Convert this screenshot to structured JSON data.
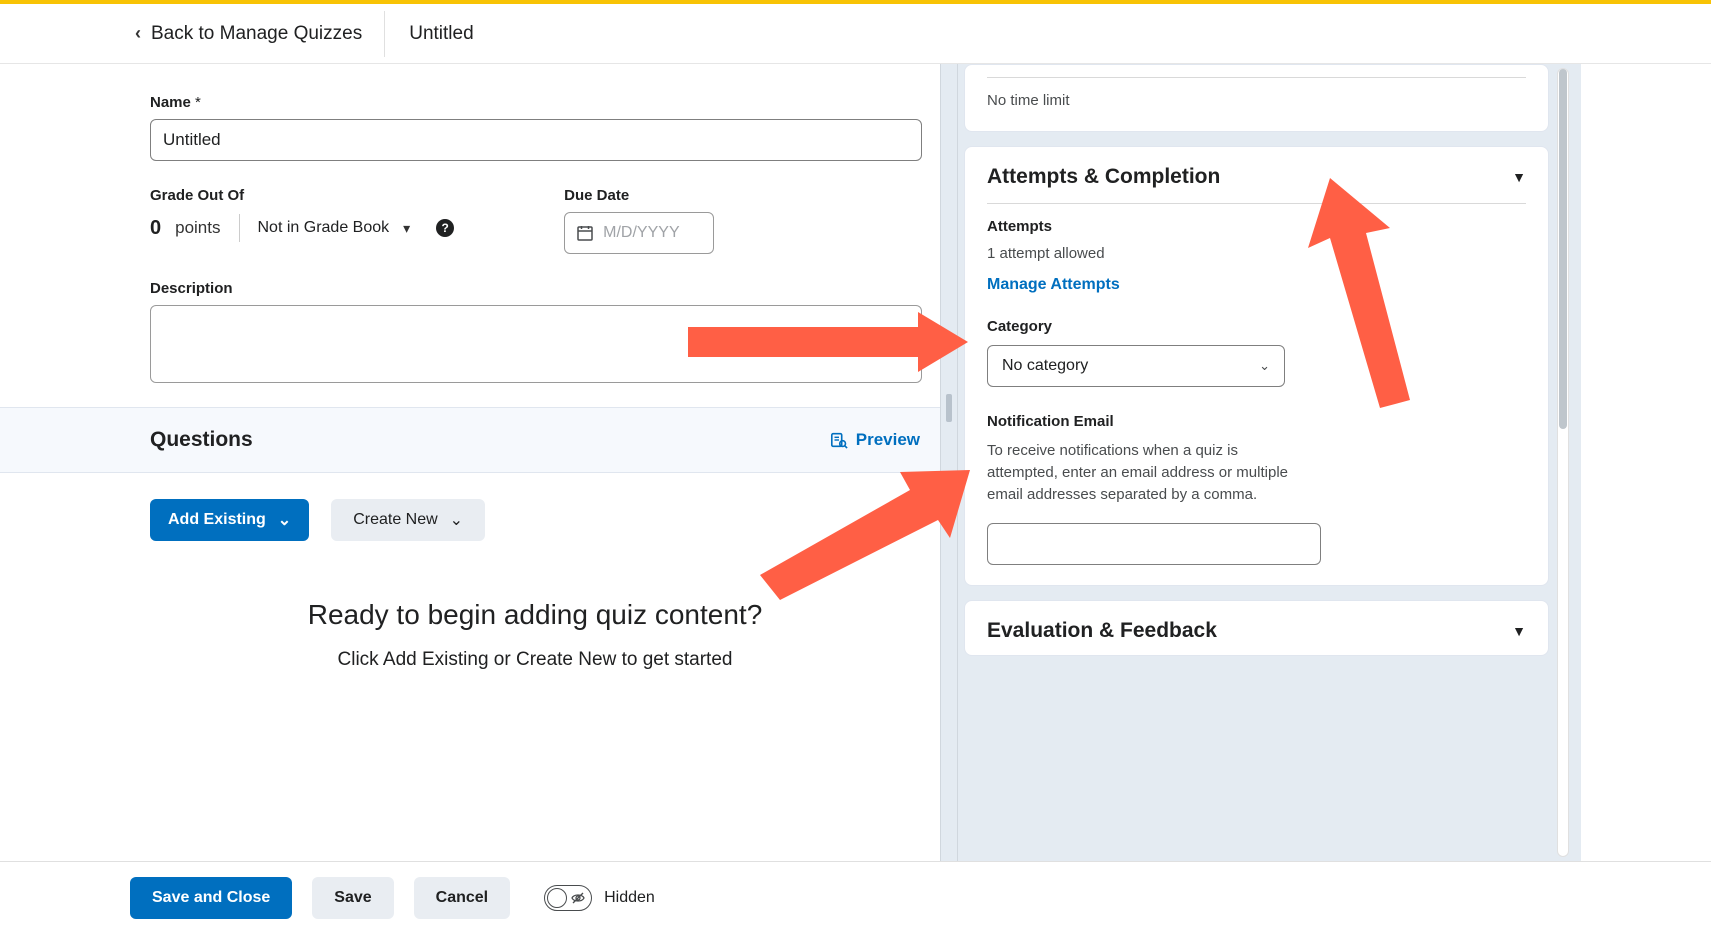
{
  "header": {
    "back_label": "Back to Manage Quizzes",
    "title": "Untitled"
  },
  "form": {
    "name_label": "Name",
    "name_value": "Untitled",
    "grade_label": "Grade Out Of",
    "grade_points_num": "0",
    "grade_points_word": "points",
    "gradebook_label": "Not in Grade Book",
    "due_date_label": "Due Date",
    "due_date_placeholder": "M/D/YYYY",
    "description_label": "Description"
  },
  "questions": {
    "heading": "Questions",
    "preview_label": "Preview",
    "add_existing_label": "Add Existing",
    "create_new_label": "Create New",
    "empty_title": "Ready to begin adding quiz content?",
    "empty_sub": "Click Add Existing or Create New to get started"
  },
  "side": {
    "timing_text": "No time limit",
    "attempts_title": "Attempts & Completion",
    "attempts_label": "Attempts",
    "attempts_value": "1 attempt allowed",
    "manage_attempts": "Manage Attempts",
    "category_label": "Category",
    "category_value": "No category",
    "notif_label": "Notification Email",
    "notif_desc": "To receive notifications when a quiz is attempted, enter an email address or multiple email addresses separated by a comma.",
    "eval_title": "Evaluation & Feedback"
  },
  "footer": {
    "save_close": "Save and Close",
    "save": "Save",
    "cancel": "Cancel",
    "hidden_label": "Hidden"
  }
}
